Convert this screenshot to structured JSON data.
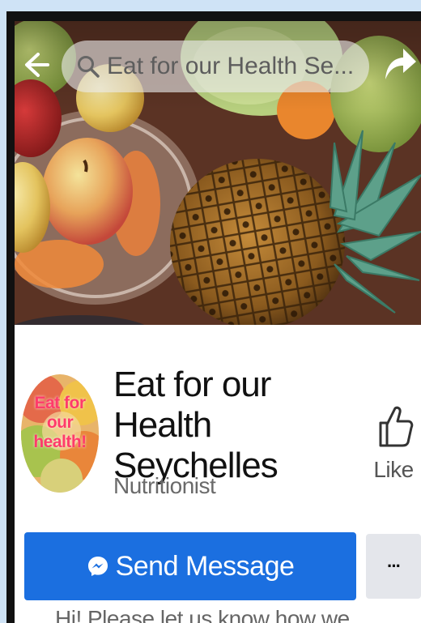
{
  "header": {
    "search_text": "Eat for our Health Se..."
  },
  "page": {
    "name": "Eat for our Health Seychelles",
    "category": "Nutritionist",
    "avatar_text": "Eat for our health!"
  },
  "actions": {
    "like_label": "Like",
    "send_message_label": "Send Message",
    "more_label": "···"
  },
  "greeting": "Hi! Please let us know how we...",
  "colors": {
    "primary": "#1b6fe0",
    "secondary_button": "#e4e6eb",
    "page_background": "#cfe3f6"
  },
  "icons": {
    "back": "arrow-left-icon",
    "search": "search-icon",
    "share": "share-arrow-icon",
    "like": "thumbs-up-icon",
    "messenger": "messenger-icon"
  }
}
